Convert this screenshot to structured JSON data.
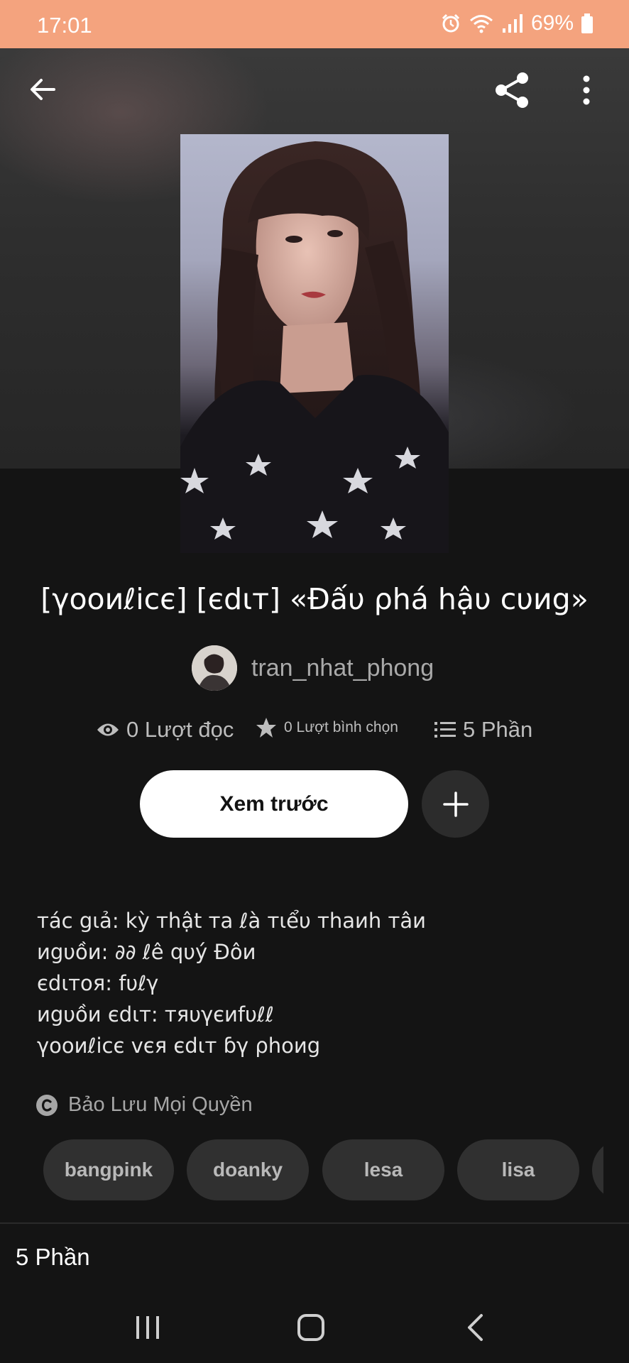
{
  "status_bar": {
    "time": "17:01",
    "battery": "69%",
    "icons": [
      "alarm-icon",
      "wifi-icon",
      "signal-icon",
      "battery-icon"
    ]
  },
  "toolbar": {
    "icons": [
      "back-arrow-icon",
      "share-icon",
      "more-vert-icon"
    ]
  },
  "story": {
    "title": "[γooиℓicє] [єdιт] «Đấυ ρhá hậυ cυиg»",
    "author": "tran_nhat_phong"
  },
  "stats": {
    "reads": "0 Lượt đọc",
    "votes": "0 Lượt bình chọn",
    "parts": "5 Phần"
  },
  "actions": {
    "preview_label": "Xem trước",
    "add_symbol": "+"
  },
  "description": [
    "тác gιả:  kỳ тhật тa ℓà тιểυ тhaиh тâи",
    "иgυồи: ∂∂ ℓê qυý Đôи",
    "єdιтoя: fυℓγ",
    "иgυồи єdιт: тяυγєиfυℓℓ",
    "γooиℓicє vєя єdιт ɓγ ρhoиg"
  ],
  "copyright": "Bảo Lưu Mọi Quyền",
  "tags": [
    "bangpink",
    "doanky",
    "lesa",
    "lisa"
  ],
  "parts_heading": "5 Phần",
  "colors": {
    "status_bar": "#f4a37e",
    "background": "#141414",
    "tag_bg": "#303030",
    "button_bg": "#ffffff"
  }
}
